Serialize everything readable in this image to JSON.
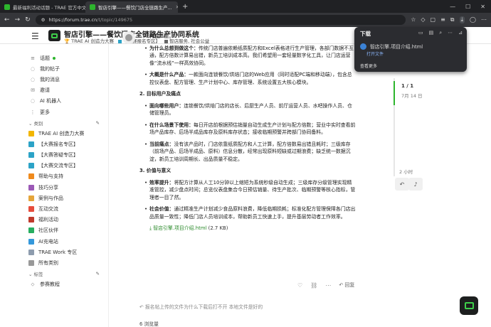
{
  "browser": {
    "tabs": [
      {
        "label": "最新福利活动话题 - TRAE 官方中文...",
        "active": false,
        "icon_color": "#2db52d"
      },
      {
        "label": "智店引擎——餐饮门店全链路生产...",
        "active": true,
        "icon_color": "#2db52d"
      }
    ],
    "url_host": "https://forum.trae.cn",
    "url_path": "/t/topic/149675"
  },
  "header": {
    "title": "智店引擎——餐饮门店全链路生产协同系统",
    "category": "TRAE AI 创造力大赛",
    "subcategory": "【大赛报名专区】",
    "tags": "智店服务, 社会公益"
  },
  "sidebar": {
    "top_items": [
      {
        "icon": "≡",
        "label": "话题",
        "badge": true
      },
      {
        "icon": "◌",
        "label": "我的帖子"
      },
      {
        "icon": "◌",
        "label": "我的消息"
      },
      {
        "icon": "✉",
        "label": "邀请"
      },
      {
        "icon": "◌",
        "label": "AI 机器人"
      },
      {
        "icon": "⋮",
        "label": "更多"
      }
    ],
    "categories_header": "类别",
    "categories": [
      {
        "label": "TRAE AI 创造力大赛",
        "color": "#f2b600"
      },
      {
        "label": "【大赛报名专区】",
        "color": "#2ca3c7"
      },
      {
        "label": "【大赛答疑专区】",
        "color": "#2ca3c7"
      },
      {
        "label": "【大赛交流专区】",
        "color": "#2ca3c7"
      },
      {
        "label": "帮助与支持",
        "color": "#ef8a1d"
      },
      {
        "label": "技巧分享",
        "color": "#9b59b6"
      },
      {
        "label": "案例与作品",
        "color": "#e5a53a"
      },
      {
        "label": "互动交流",
        "color": "#e74c3c"
      },
      {
        "label": "福利活动",
        "color": "#c0392b"
      },
      {
        "label": "社区伙伴",
        "color": "#27ae60"
      },
      {
        "label": "AI充电站",
        "color": "#3498db"
      },
      {
        "label": "TRAE Work 专区",
        "color": "#8e9cae"
      },
      {
        "label": "所有类别",
        "color": "#999999"
      }
    ],
    "tags_header": "标签",
    "tags": [
      {
        "label": "参赛教程"
      }
    ]
  },
  "post": {
    "intro": "描述传统门店从门店人员、库存管理到生产计划的流程，等效降低门店和数据管理人员的时间与精力成本。",
    "intro_tail": "耗费严重。",
    "bullets1": [
      {
        "b": "为什么总想到做这个：",
        "t": "传统门店普遍依赖纸质配方和Excel表格进行生产管理，各部门数据不互通，配方倍数计算易出错，新员工培训成本高。我们希望用一套轻量数字化工具，让门店运营像“流水线”一样高效协同。"
      },
      {
        "b": "大概是什么产品：",
        "t": "一款面向连锁餐饮/烘焙门店的Web应用（同时适配PC端和移动端），包含总控仪表盘、配方管理、生产计划中心、库存管理、系统设置五大核心模块。"
      }
    ],
    "section2": "2. 目标用户及痛点",
    "bullets2": [
      {
        "b": "面向哪些用户：",
        "t": "连锁餐饮/烘焙门店的店长、后厨生产人员、前厅运营人员、水吧操作人员、仓储管理员。"
      },
      {
        "b": "在什么场景下使用：",
        "t": "每日开店前根据预估销量自动生成生产计划与配方倍数；营业中实时查看前场产品库存、后场半成品库存及原料库存状态；接收临期预警并跨部门协同备料。"
      },
      {
        "b": "当前痛点：",
        "t": "没有该产品时，门店依靠纸质配方和人工计算，配方倍数易出错且耗时；三级库存（前场产品、后场半成品、原料）信息分散，经常出现原料短缺或过期浪费；缺乏统一数据沉淀，新员工培训周期长、出品质量不稳定。"
      }
    ],
    "section3": "3. 价值与意义",
    "bullets3": [
      {
        "b": "效率提升：",
        "t": "将配方计算从人工10分钟以上缩短为系统秒级自动生成；三级库存分级管理实现精准管控，减少盘点时间；总览仪表盘集合今日预估销量、待生产批次、临期预警等核心指标，管理者一目了然。"
      },
      {
        "b": "社会价值：",
        "t": "通过精准生产计划减少食品原料浪费，降低临期损耗；标准化配方管理保障各门店出品质量一致性；降低门店人员培训成本，帮助新员工快速上手，提升基层劳动者工作效率。"
      }
    ],
    "attachment_name": "智店引擎.项目介绍.html",
    "attachment_size": "(2.7 KB)",
    "reply_label": "回复",
    "suggestion": "报名帖上传的文件为什么下载后打不开 本地文件是好的",
    "views": "6 浏览量"
  },
  "timeline": {
    "counter": "1 / 1",
    "date": "7月 14 日",
    "ago": "2 小时"
  },
  "downloads": {
    "title": "下载",
    "file": "智店引擎.项目介绍.html",
    "open": "打开文件",
    "more": "查看更多"
  },
  "colors": {
    "accent": "#2db52d",
    "chrome_dark": "#202124"
  }
}
